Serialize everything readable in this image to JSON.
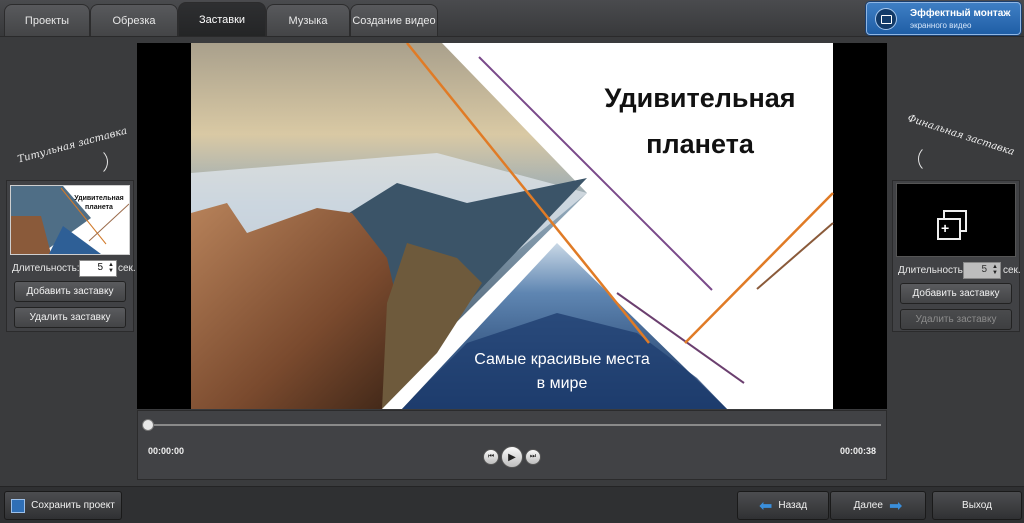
{
  "tabs": [
    "Проекты",
    "Обрезка",
    "Заставки",
    "Музыка",
    "Создание видео"
  ],
  "brand": {
    "line1": "Эффектный монтаж",
    "line2": "экранного видео"
  },
  "left_panel": {
    "caption": "Титульная заставка",
    "thumb_title": "Удивительная планета",
    "duration_label": "Длительность:",
    "duration_value": "5",
    "duration_unit": "сек.",
    "add_label": "Добавить заставку",
    "delete_label": "Удалить заставку"
  },
  "right_panel": {
    "caption": "Финальная заставка",
    "duration_label": "Длительность:",
    "duration_value": "5",
    "duration_unit": "сек.",
    "add_label": "Добавить заставку",
    "delete_label": "Удалить заставку"
  },
  "preview": {
    "title_line1": "Удивительная",
    "title_line2": "планета",
    "subtitle_line1": "Самые красивые места",
    "subtitle_line2": "в мире"
  },
  "player": {
    "time_current": "00:00:00",
    "time_total": "00:00:38",
    "progress": 0
  },
  "footer": {
    "save_label": "Сохранить проект",
    "back_label": "Назад",
    "next_label": "Далее",
    "exit_label": "Выход"
  },
  "colors": {
    "accent": "#2f6fb6",
    "arrow": "#3a8fdc"
  }
}
